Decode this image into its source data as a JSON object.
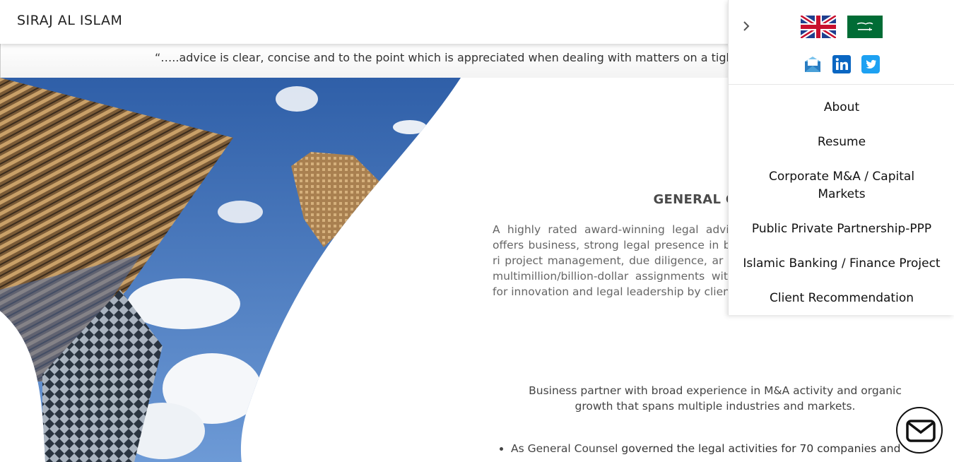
{
  "header": {
    "site_title": "SIRAJ AL ISLAM"
  },
  "ticker": {
    "text": "“…..advice is clear, concise and to the point which is appreciated when dealing with matters on a tight deadline”"
  },
  "side_panel": {
    "toggle_icon": "chevron-right-icon",
    "languages": [
      {
        "name": "uk-flag-icon"
      },
      {
        "name": "saudi-flag-icon"
      }
    ],
    "social": [
      {
        "name": "email-icon"
      },
      {
        "name": "linkedin-icon"
      },
      {
        "name": "twitter-icon"
      }
    ],
    "menu": [
      {
        "label": "About"
      },
      {
        "label": "Resume"
      },
      {
        "label": "Corporate M&A / Capital Markets"
      },
      {
        "label": "Public Private Partnership-PPP"
      },
      {
        "label": "Islamic Banking / Finance Project"
      },
      {
        "label": "Client Recommendation"
      }
    ]
  },
  "main": {
    "heading": "GENERAL COUNS",
    "intro": "A highly rated award-winning legal advis Project Finance and Restructuring offers business, strong legal presence in bu litigation, and leadership regarding ri project management, due diligence, ar M&As, JVs, and divestitures. Experien multimillion/billion-dollar assignments with international partners. Recognised for innovation and legal leadership by clients and leading industry publications.",
    "tagline": "Business partner with broad experience in M&A activity and organic growth that spans multiple industries and markets.",
    "bullets": [
      {
        "lead": "As General Counsel ",
        "rest": "governed the legal activities for 70 companies and"
      }
    ]
  },
  "colors": {
    "accent_linkedin": "#0a66c2",
    "accent_twitter": "#1da1f2",
    "sky": "#3f6fb5"
  },
  "fab": {
    "icon": "mail-icon"
  }
}
